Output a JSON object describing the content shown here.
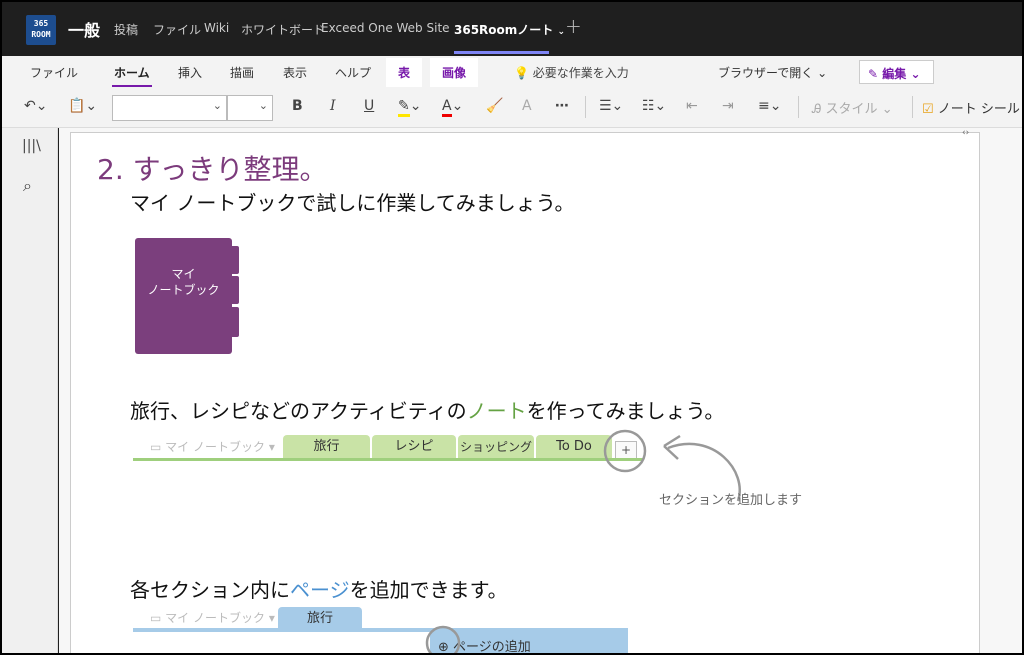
{
  "topbar": {
    "logo": "365\nROOM",
    "channel": "一般",
    "tabs": [
      "投稿",
      "ファイル",
      "Wiki",
      "ホワイトボード",
      "Exceed One Web Site",
      "365Roomノート"
    ],
    "add_tab": "+"
  },
  "ribbon": {
    "menus": [
      "ファイル",
      "ホーム",
      "挿入",
      "描画",
      "表示",
      "ヘルプ",
      "表",
      "画像"
    ],
    "tell_me": "必要な作業を入力",
    "open_in_browser": "ブラウザーで開く",
    "edit_button": "編集",
    "style_label": "スタイル",
    "note_tag_label": "ノート シール"
  },
  "page": {
    "heading": "2. すっきり整理。",
    "line1": "マイ ノートブックで試しに作業してみましょう。",
    "book_label_1": "マイ",
    "book_label_2": "ノートブック",
    "line2_a": "旅行、レシピなどのアクティビティの",
    "line2_b": "ノート",
    "line2_c": "を作ってみましょう。",
    "ghost_notebook": "マイ ノートブック",
    "sections": [
      "旅行",
      "レシピ",
      "ショッピング",
      "To Do"
    ],
    "add_section_symbol": "+",
    "callout_section": "セクションを追加します",
    "line3_a": "各セクション内に",
    "line3_b": "ページ",
    "line3_c": "を追加できます。",
    "page_tab": "旅行",
    "add_page": "ページの追加"
  }
}
